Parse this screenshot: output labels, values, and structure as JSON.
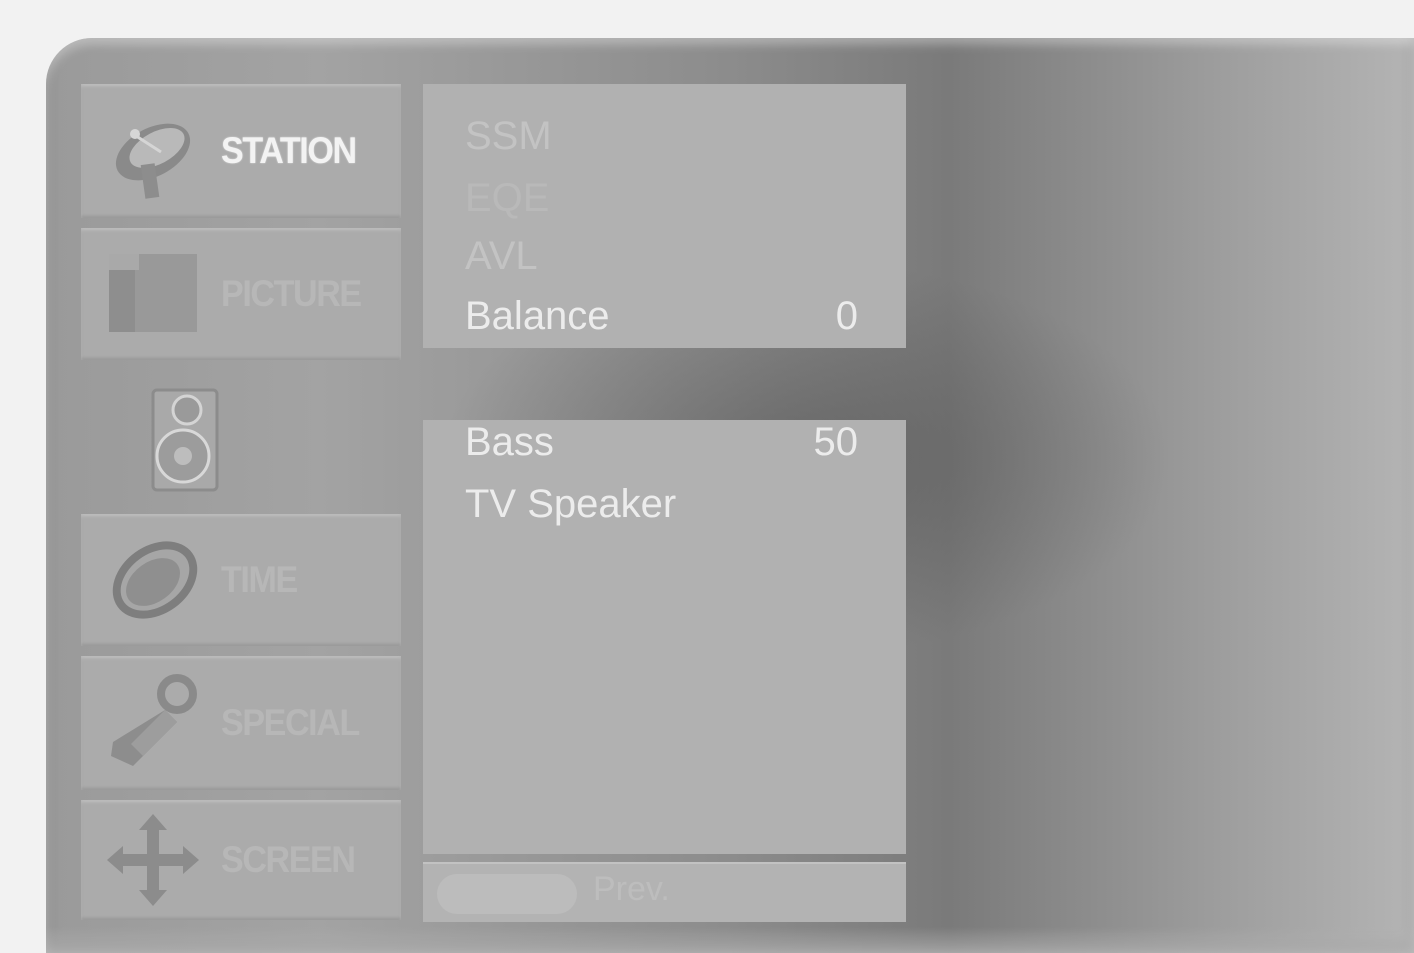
{
  "menu": {
    "categories": [
      {
        "label": "STATION",
        "icon": "satellite-dish-icon",
        "state": "highlighted"
      },
      {
        "label": "PICTURE",
        "icon": "picture-icon",
        "state": "dim"
      },
      {
        "label": "",
        "icon": "speaker-icon",
        "state": "active"
      },
      {
        "label": "TIME",
        "icon": "clock-icon",
        "state": "dim"
      },
      {
        "label": "SPECIAL",
        "icon": "key-tag-icon",
        "state": "dim"
      },
      {
        "label": "SCREEN",
        "icon": "move-arrows-icon",
        "state": "dim"
      }
    ]
  },
  "audio": {
    "upper_items": [
      {
        "name": "SSM",
        "value": ""
      },
      {
        "name": "EQE",
        "value": ""
      },
      {
        "name": "AVL",
        "value": ""
      },
      {
        "name": "Balance",
        "value": "0"
      }
    ],
    "lower_items": [
      {
        "name": "Bass",
        "value": "50"
      },
      {
        "name": "TV Speaker",
        "value": ""
      }
    ]
  },
  "footer": {
    "label": "Prev."
  },
  "colors": {
    "osd_background": "#9a9a9a",
    "panel": "#b1b1b1",
    "text_bright": "#ececec"
  }
}
